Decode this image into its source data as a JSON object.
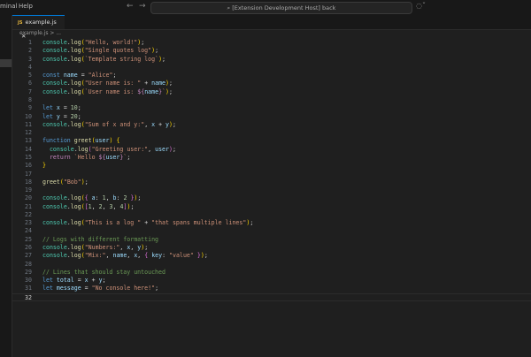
{
  "menu": [
    "minal",
    "Help"
  ],
  "search": {
    "text": "[Extension Development Host] back"
  },
  "tab": {
    "label": "example.js",
    "icon": "JS"
  },
  "breadcrumb": "example.js > ...",
  "current_line": 32,
  "lines": [
    [
      [
        "console",
        "t-obj"
      ],
      [
        ".",
        "t-p"
      ],
      [
        "log",
        "t-fn"
      ],
      [
        "(",
        "t-b1"
      ],
      [
        "\"Hello, world!\"",
        "t-str"
      ],
      [
        ")",
        "t-b1"
      ],
      [
        ";",
        "t-p"
      ]
    ],
    [
      [
        "console",
        "t-obj"
      ],
      [
        ".",
        "t-p"
      ],
      [
        "log",
        "t-fn"
      ],
      [
        "(",
        "t-b1"
      ],
      [
        "\"Single quotes log\"",
        "t-str"
      ],
      [
        ")",
        "t-b1"
      ],
      [
        ";",
        "t-p"
      ]
    ],
    [
      [
        "console",
        "t-obj"
      ],
      [
        ".",
        "t-p"
      ],
      [
        "log",
        "t-fn"
      ],
      [
        "(",
        "t-b1"
      ],
      [
        "`Template string log`",
        "t-str"
      ],
      [
        ")",
        "t-b1"
      ],
      [
        ";",
        "t-p"
      ]
    ],
    [],
    [
      [
        "const ",
        "t-kw"
      ],
      [
        "name",
        "t-var"
      ],
      [
        " = ",
        "t-p"
      ],
      [
        "\"Alice\"",
        "t-str"
      ],
      [
        ";",
        "t-p"
      ]
    ],
    [
      [
        "console",
        "t-obj"
      ],
      [
        ".",
        "t-p"
      ],
      [
        "log",
        "t-fn"
      ],
      [
        "(",
        "t-b1"
      ],
      [
        "\"User name is: \"",
        "t-str"
      ],
      [
        " + ",
        "t-p"
      ],
      [
        "name",
        "t-var"
      ],
      [
        ")",
        "t-b1"
      ],
      [
        ";",
        "t-p"
      ]
    ],
    [
      [
        "console",
        "t-obj"
      ],
      [
        ".",
        "t-p"
      ],
      [
        "log",
        "t-fn"
      ],
      [
        "(",
        "t-b1"
      ],
      [
        "`User name is: ",
        "t-str"
      ],
      [
        "${",
        "t-kw2"
      ],
      [
        "name",
        "t-var"
      ],
      [
        "}",
        "t-kw2"
      ],
      [
        "`",
        "t-str"
      ],
      [
        ")",
        "t-b1"
      ],
      [
        ";",
        "t-p"
      ]
    ],
    [],
    [
      [
        "let ",
        "t-kw"
      ],
      [
        "x",
        "t-var"
      ],
      [
        " = ",
        "t-p"
      ],
      [
        "10",
        "t-num"
      ],
      [
        ";",
        "t-p"
      ]
    ],
    [
      [
        "let ",
        "t-kw"
      ],
      [
        "y",
        "t-var"
      ],
      [
        " = ",
        "t-p"
      ],
      [
        "20",
        "t-num"
      ],
      [
        ";",
        "t-p"
      ]
    ],
    [
      [
        "console",
        "t-obj"
      ],
      [
        ".",
        "t-p"
      ],
      [
        "log",
        "t-fn"
      ],
      [
        "(",
        "t-b1"
      ],
      [
        "\"Sum of x and y:\"",
        "t-str"
      ],
      [
        ", ",
        "t-p"
      ],
      [
        "x",
        "t-var"
      ],
      [
        " + ",
        "t-p"
      ],
      [
        "y",
        "t-var"
      ],
      [
        ")",
        "t-b1"
      ],
      [
        ";",
        "t-p"
      ]
    ],
    [],
    [
      [
        "function ",
        "t-kw"
      ],
      [
        "greet",
        "t-fn"
      ],
      [
        "(",
        "t-b1"
      ],
      [
        "user",
        "t-var"
      ],
      [
        ")",
        "t-b1"
      ],
      [
        " ",
        "t-p"
      ],
      [
        "{",
        "t-b1"
      ]
    ],
    [
      [
        "  console",
        "t-obj"
      ],
      [
        ".",
        "t-p"
      ],
      [
        "log",
        "t-fn"
      ],
      [
        "(",
        "t-b2"
      ],
      [
        "\"Greeting user:\"",
        "t-str"
      ],
      [
        ", ",
        "t-p"
      ],
      [
        "user",
        "t-var"
      ],
      [
        ")",
        "t-b2"
      ],
      [
        ";",
        "t-p"
      ]
    ],
    [
      [
        "  return ",
        "t-kw2"
      ],
      [
        "`Hello ",
        "t-str"
      ],
      [
        "${",
        "t-kw2"
      ],
      [
        "user",
        "t-var"
      ],
      [
        "}",
        "t-kw2"
      ],
      [
        "`",
        "t-str"
      ],
      [
        ";",
        "t-p"
      ]
    ],
    [
      [
        "}",
        "t-b1"
      ]
    ],
    [],
    [
      [
        "greet",
        "t-fn"
      ],
      [
        "(",
        "t-b1"
      ],
      [
        "\"Bob\"",
        "t-str"
      ],
      [
        ")",
        "t-b1"
      ],
      [
        ";",
        "t-p"
      ]
    ],
    [],
    [
      [
        "console",
        "t-obj"
      ],
      [
        ".",
        "t-p"
      ],
      [
        "log",
        "t-fn"
      ],
      [
        "(",
        "t-b1"
      ],
      [
        "{",
        "t-b2"
      ],
      [
        " a",
        "t-var"
      ],
      [
        ": ",
        "t-p"
      ],
      [
        "1",
        "t-num"
      ],
      [
        ", ",
        "t-p"
      ],
      [
        "b",
        "t-var"
      ],
      [
        ": ",
        "t-p"
      ],
      [
        "2",
        "t-num"
      ],
      [
        " }",
        "t-b2"
      ],
      [
        ")",
        "t-b1"
      ],
      [
        ";",
        "t-p"
      ]
    ],
    [
      [
        "console",
        "t-obj"
      ],
      [
        ".",
        "t-p"
      ],
      [
        "log",
        "t-fn"
      ],
      [
        "(",
        "t-b1"
      ],
      [
        "[",
        "t-b2"
      ],
      [
        "1",
        "t-num"
      ],
      [
        ", ",
        "t-p"
      ],
      [
        "2",
        "t-num"
      ],
      [
        ", ",
        "t-p"
      ],
      [
        "3",
        "t-num"
      ],
      [
        ", ",
        "t-p"
      ],
      [
        "4",
        "t-num"
      ],
      [
        "]",
        "t-b2"
      ],
      [
        ")",
        "t-b1"
      ],
      [
        ";",
        "t-p"
      ]
    ],
    [],
    [
      [
        "console",
        "t-obj"
      ],
      [
        ".",
        "t-p"
      ],
      [
        "log",
        "t-fn"
      ],
      [
        "(",
        "t-b1"
      ],
      [
        "\"This is a log \"",
        "t-str"
      ],
      [
        " + ",
        "t-p"
      ],
      [
        "\"that spans multiple lines\"",
        "t-str"
      ],
      [
        ")",
        "t-b1"
      ],
      [
        ";",
        "t-p"
      ]
    ],
    [],
    [
      [
        "// Logs with different formatting",
        "t-com"
      ]
    ],
    [
      [
        "console",
        "t-obj"
      ],
      [
        ".",
        "t-p"
      ],
      [
        "log",
        "t-fn"
      ],
      [
        "(",
        "t-b1"
      ],
      [
        "\"Numbers:\"",
        "t-str"
      ],
      [
        ", ",
        "t-p"
      ],
      [
        "x",
        "t-var"
      ],
      [
        ", ",
        "t-p"
      ],
      [
        "y",
        "t-var"
      ],
      [
        ")",
        "t-b1"
      ],
      [
        ";",
        "t-p"
      ]
    ],
    [
      [
        "console",
        "t-obj"
      ],
      [
        ".",
        "t-p"
      ],
      [
        "log",
        "t-fn"
      ],
      [
        "(",
        "t-b1"
      ],
      [
        "\"Mix:\"",
        "t-str"
      ],
      [
        ", ",
        "t-p"
      ],
      [
        "name",
        "t-var"
      ],
      [
        ", ",
        "t-p"
      ],
      [
        "x",
        "t-var"
      ],
      [
        ", ",
        "t-p"
      ],
      [
        "{",
        "t-b2"
      ],
      [
        " key",
        "t-var"
      ],
      [
        ": ",
        "t-p"
      ],
      [
        "\"value\"",
        "t-str"
      ],
      [
        " }",
        "t-b2"
      ],
      [
        ")",
        "t-b1"
      ],
      [
        ";",
        "t-p"
      ]
    ],
    [],
    [
      [
        "// Lines that should stay untouched",
        "t-com"
      ]
    ],
    [
      [
        "let ",
        "t-kw"
      ],
      [
        "total",
        "t-var"
      ],
      [
        " = ",
        "t-p"
      ],
      [
        "x",
        "t-var"
      ],
      [
        " + ",
        "t-p"
      ],
      [
        "y",
        "t-var"
      ],
      [
        ";",
        "t-p"
      ]
    ],
    [
      [
        "let ",
        "t-kw"
      ],
      [
        "message",
        "t-var"
      ],
      [
        " = ",
        "t-p"
      ],
      [
        "\"No console here!\"",
        "t-str"
      ],
      [
        ";",
        "t-p"
      ]
    ],
    []
  ]
}
